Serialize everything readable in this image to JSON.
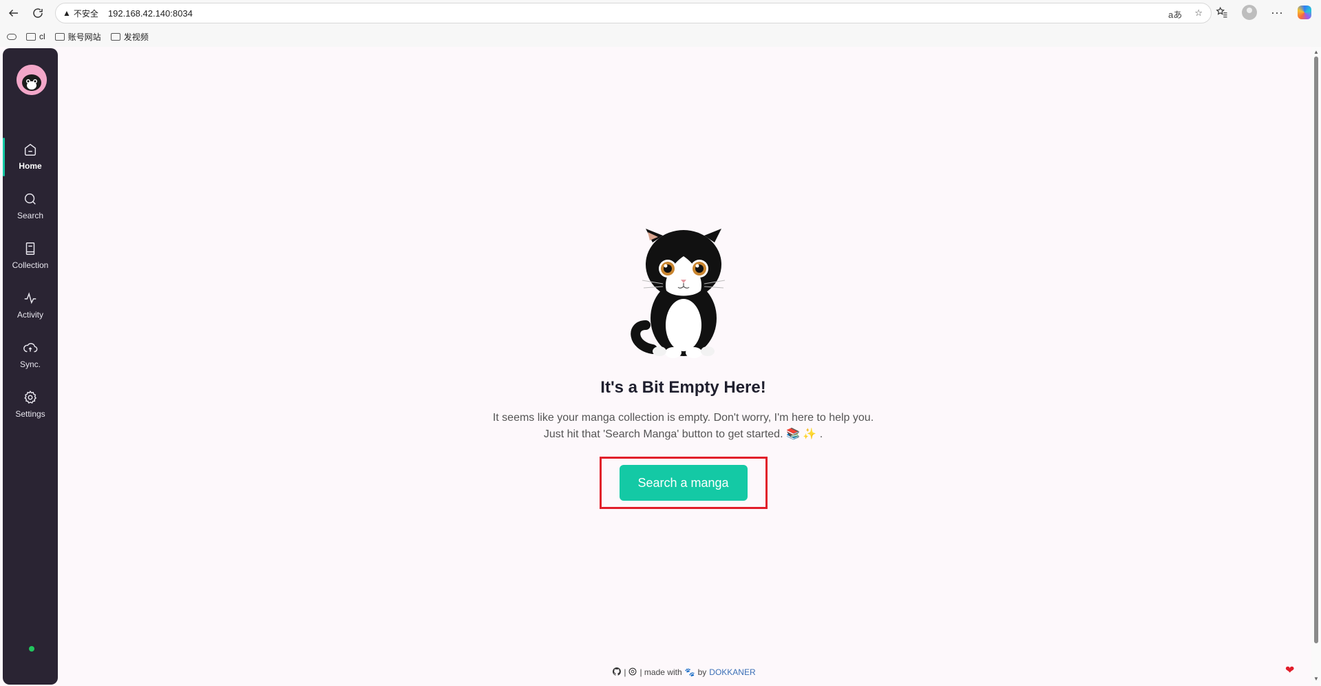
{
  "browser": {
    "insecure_label": "不安全",
    "url": "192.168.42.140:8034",
    "translate_label": "aあ"
  },
  "bookmarks": [
    {
      "label": "cl"
    },
    {
      "label": "账号网站"
    },
    {
      "label": "发视频"
    }
  ],
  "sidebar": {
    "items": [
      {
        "label": "Home",
        "icon": "home-icon"
      },
      {
        "label": "Search",
        "icon": "search-icon"
      },
      {
        "label": "Collection",
        "icon": "book-icon"
      },
      {
        "label": "Activity",
        "icon": "activity-icon"
      },
      {
        "label": "Sync.",
        "icon": "cloud-sync-icon"
      },
      {
        "label": "Settings",
        "icon": "gear-icon"
      }
    ],
    "active": "Home"
  },
  "empty_state": {
    "title": "It's a Bit Empty Here!",
    "line1": "It seems like your manga collection is empty. Don't worry, I'm here to help you.",
    "line2": "Just hit that 'Search Manga' button to get started. 📚 ✨ .",
    "button_label": "Search a manga"
  },
  "footer": {
    "separator1": "|",
    "separator2": "| made with",
    "by": "by",
    "author": "DOKKANER"
  },
  "colors": {
    "accent": "#14c9a5",
    "sidebar_bg": "#2a2433",
    "page_bg": "#fdf8fb",
    "highlight": "#e11d2a"
  }
}
